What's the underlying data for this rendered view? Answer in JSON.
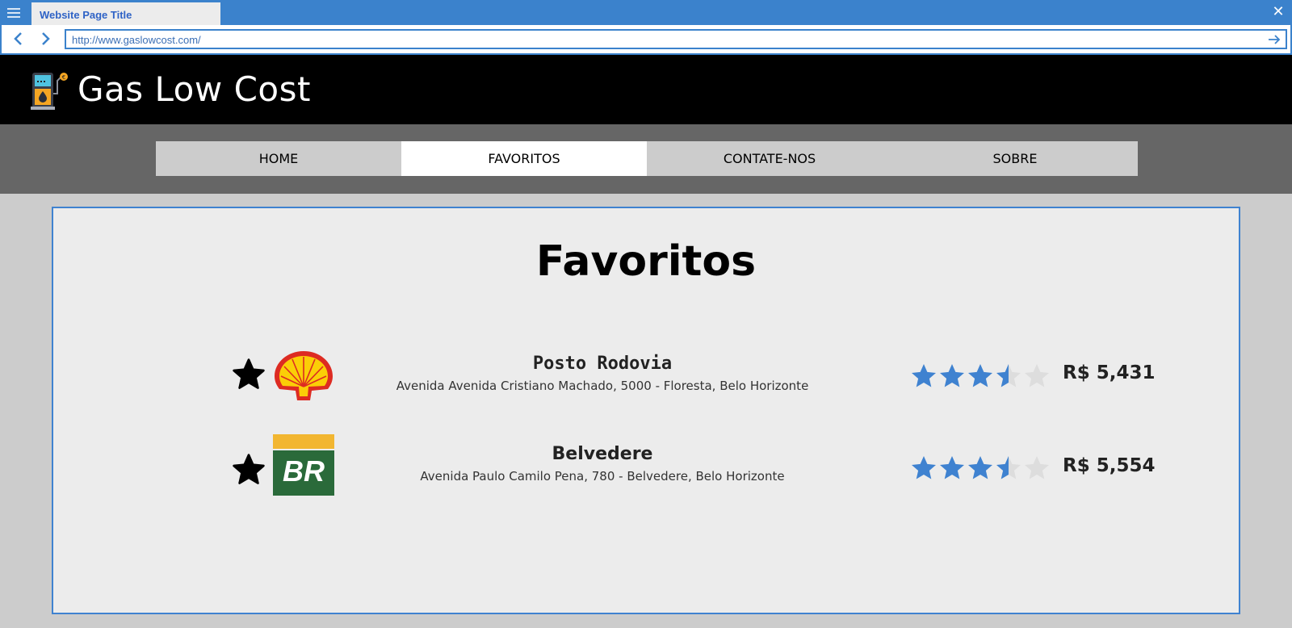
{
  "browser": {
    "tab_title": "Website Page Title",
    "url": "http://www.gaslowcost.com/"
  },
  "site": {
    "title": "Gas Low Cost",
    "nav": [
      "HOME",
      "FAVORITOS",
      "CONTATE-NOS",
      "SOBRE"
    ],
    "active_nav": "FAVORITOS"
  },
  "page": {
    "title": "Favoritos"
  },
  "stations": [
    {
      "name": "Posto Rodovia",
      "address": "Avenida Avenida Cristiano Machado, 5000 - Floresta, Belo Horizonte",
      "brand": "shell-logo",
      "rating": 3.5,
      "price": "R$ 5,431"
    },
    {
      "name": "Belvedere",
      "address": "Avenida Paulo Camilo Pena, 780 - Belvedere, Belo Horizonte",
      "brand": "br-petrobras-logo",
      "rating": 3.5,
      "price": "R$ 5,554"
    }
  ],
  "colors": {
    "accent": "#3b82cc",
    "star_filled": "#3f82d0",
    "star_empty": "#dddddd",
    "header_bg": "#000000",
    "nav_strip_bg": "#666666"
  }
}
